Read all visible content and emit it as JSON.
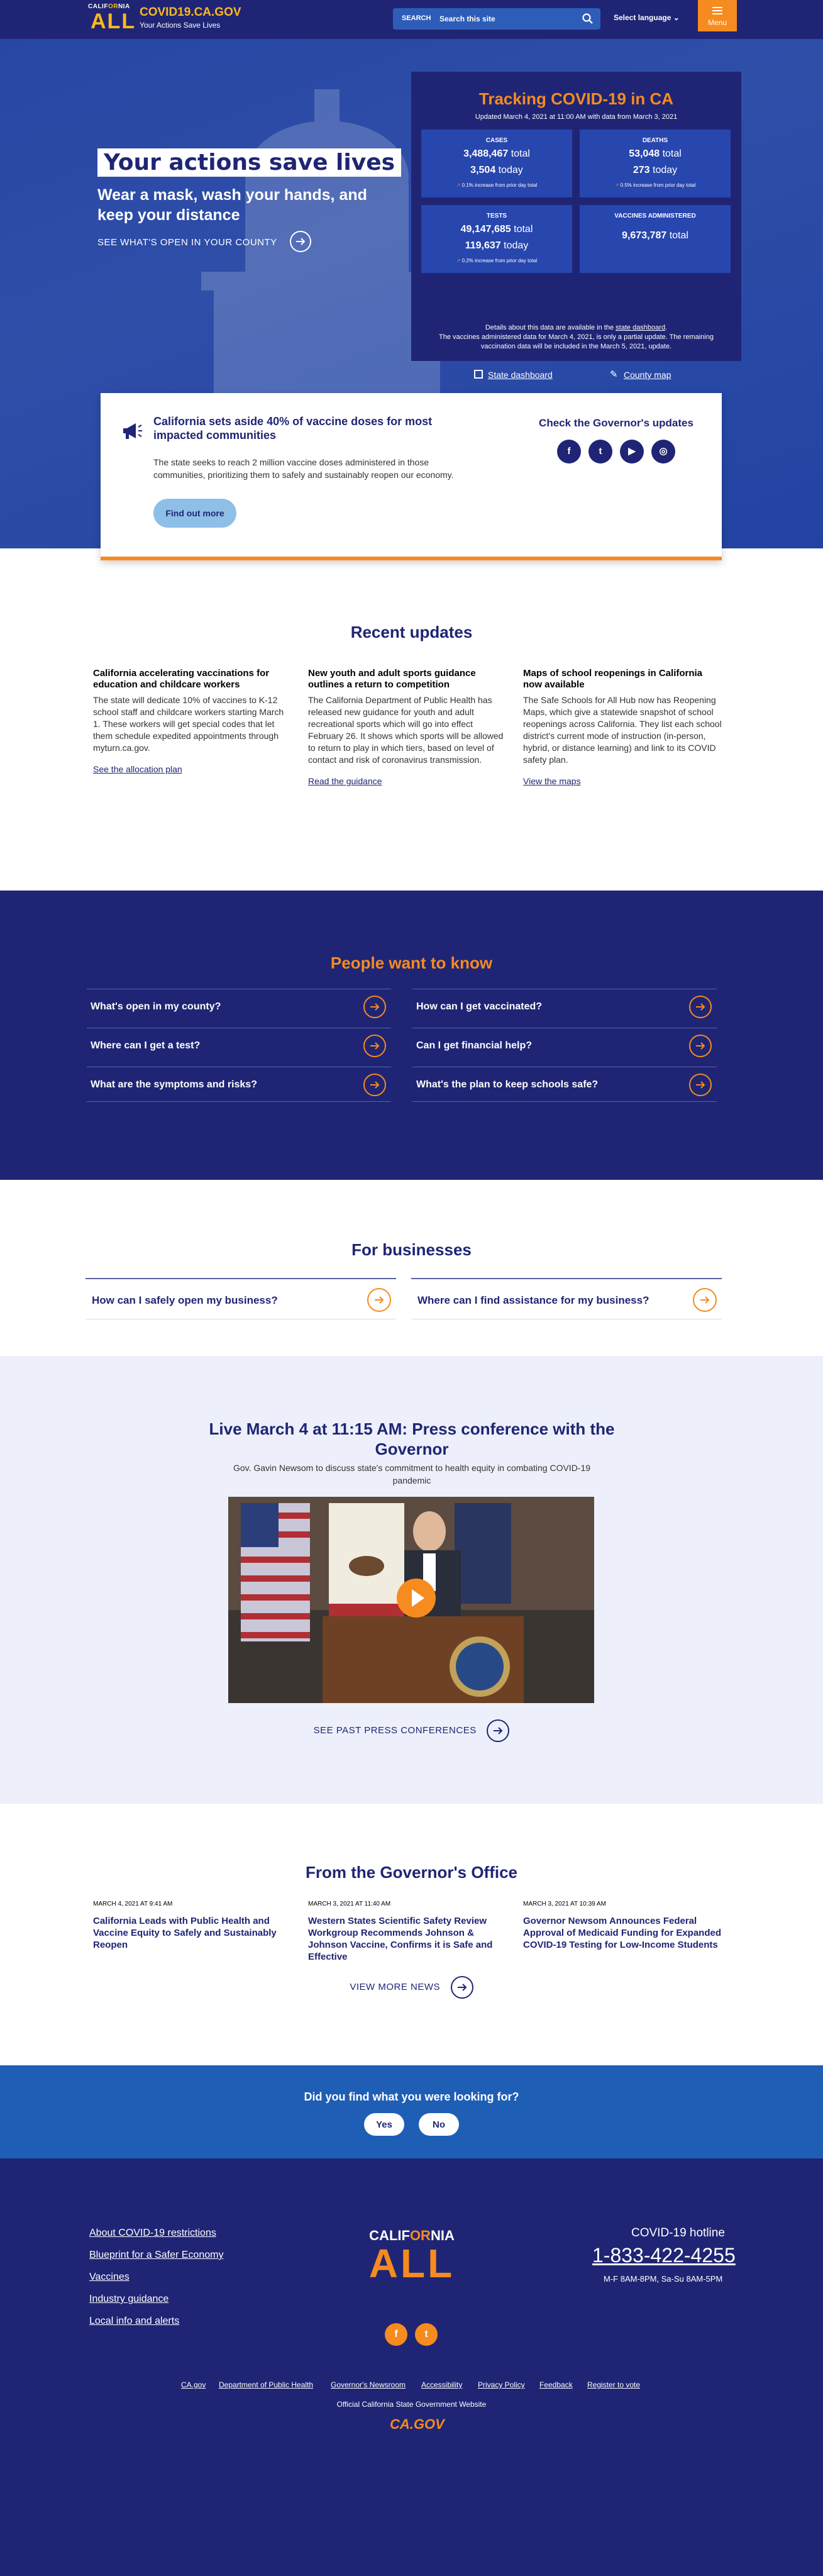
{
  "header": {
    "logo_top_left": "CALIF",
    "logo_top_mid": "OR",
    "logo_top_right": "NIA",
    "logo_all": "ALL",
    "site_title": "COVID19.CA.GOV",
    "site_tagline": "Your Actions Save Lives",
    "search_label": "SEARCH",
    "search_placeholder": "Search this site",
    "language": "Select language",
    "menu": "Menu"
  },
  "hero": {
    "title": "Your actions save lives",
    "subtitle": "Wear a mask, wash your hands, and keep your distance",
    "link": "SEE WHAT'S OPEN IN YOUR COUNTY"
  },
  "tracker": {
    "title": "Tracking COVID-19 in CA",
    "updated": "Updated March 4, 2021 at 11:00 AM with data from March 3, 2021",
    "cases": {
      "label": "CASES",
      "total": "3,488,467",
      "total_suffix": " total",
      "today": "3,504",
      "today_suffix": " today",
      "change": "0.1% increase from prior day total"
    },
    "deaths": {
      "label": "DEATHS",
      "total": "53,048",
      "total_suffix": " total",
      "today": "273",
      "today_suffix": " today",
      "change": "0.5% increase from prior day total"
    },
    "tests": {
      "label": "TESTS",
      "total": "49,147,685",
      "total_suffix": " total",
      "today": "119,637",
      "today_suffix": " today",
      "change": "0.2% increase from prior day total"
    },
    "vaccines": {
      "label": "VACCINES ADMINISTERED",
      "total": "9,673,787",
      "total_suffix": " total"
    },
    "details_pre": "Details about this data are available in the ",
    "details_link": "state dashboard",
    "details_post": ".",
    "vaccine_note": "The vaccines administered data for March 4, 2021, is only a partial update. The remaining vaccination data will be included in the March 5, 2021, update.",
    "dashboard_link": "State dashboard",
    "map_link": "County map"
  },
  "announcement": {
    "title": "California sets aside 40% of vaccine doses for most impacted communities",
    "body": "The state seeks to reach 2 million vaccine doses administered in those communities, prioritizing them to safely and sustainably reopen our economy.",
    "button": "Find out more",
    "governor_title": "Check the Governor's updates"
  },
  "recent": {
    "title": "Recent updates",
    "items": [
      {
        "title": "California accelerating vaccinations for education and childcare workers",
        "body": "The state will dedicate 10% of vaccines to K-12 school staff and childcare workers starting March 1. These workers will get special codes that let them schedule expedited appointments through myturn.ca.gov.",
        "link": "See the allocation plan"
      },
      {
        "title": "New youth and adult sports guidance outlines a return to competition",
        "body": "The California Department of Public Health has released new guidance for youth and adult recreational sports which will go into effect February 26. It shows which sports will be allowed to return to play in which tiers, based on level of contact and risk of coronavirus transmission.",
        "link": "Read the guidance"
      },
      {
        "title": "Maps of school reopenings in California now available",
        "body": "The Safe Schools for All Hub now has Reopening Maps, which give a statewide snapshot of school reopenings across California. They list each school district's current mode of instruction (in-person, hybrid, or distance learning) and link to its COVID safety plan.",
        "link": "View the maps"
      }
    ]
  },
  "people": {
    "title": "People want to know",
    "questions": [
      "What's open in my county?",
      "How can I get vaccinated?",
      "Where can I get a test?",
      "Can I get financial help?",
      "What are the symptoms and risks?",
      "What's the plan to keep schools safe?"
    ]
  },
  "business": {
    "title": "For businesses",
    "questions": [
      "How can I safely open my business?",
      "Where can I find assistance for my business?"
    ]
  },
  "live": {
    "title": "Live March 4 at 11:15 AM: Press conference with the Governor",
    "desc": "Gov. Gavin Newsom to discuss state's commitment to health equity in combating COVID-19 pandemic",
    "past_link": "SEE PAST PRESS CONFERENCES"
  },
  "governor": {
    "title": "From the Governor's Office",
    "news": [
      {
        "date": "MARCH 4, 2021 AT 9:41 AM",
        "title": "California Leads with Public Health and Vaccine Equity to Safely and Sustainably Reopen"
      },
      {
        "date": "MARCH 3, 2021 AT 11:40 AM",
        "title": "Western States Scientific Safety Review Workgroup Recommends Johnson & Johnson Vaccine, Confirms it is Safe and Effective"
      },
      {
        "date": "MARCH 3, 2021 AT 10:39 AM",
        "title": "Governor Newsom Announces Federal Approval of Medicaid Funding for Expanded COVID-19 Testing for Low-Income Students"
      }
    ],
    "more": "VIEW MORE NEWS"
  },
  "feedback": {
    "question": "Did you find what you were looking for?",
    "yes": "Yes",
    "no": "No"
  },
  "footer": {
    "links": [
      "About COVID-19 restrictions",
      "Blueprint for a Safer Economy",
      "Vaccines",
      "Industry guidance",
      "Local info and alerts"
    ],
    "hotline_label": "COVID-19 hotline",
    "hotline_number": "1-833-422-4255",
    "hotline_hours": "M-F 8AM-8PM, Sa-Su 8AM-5PM",
    "bottom_links": [
      "CA.gov",
      "Department of Public Health",
      "Governor's Newsroom",
      "Accessibility",
      "Privacy Policy",
      "Feedback",
      "Register to vote"
    ],
    "official": "Official California State Government Website",
    "cagov": "CA.GOV"
  },
  "colors": {
    "navy": "#1f2574",
    "orange": "#f68b1f",
    "gold": "#fdb81e",
    "hero_blue": "#2747a5",
    "light_bg": "#edf0fa"
  }
}
